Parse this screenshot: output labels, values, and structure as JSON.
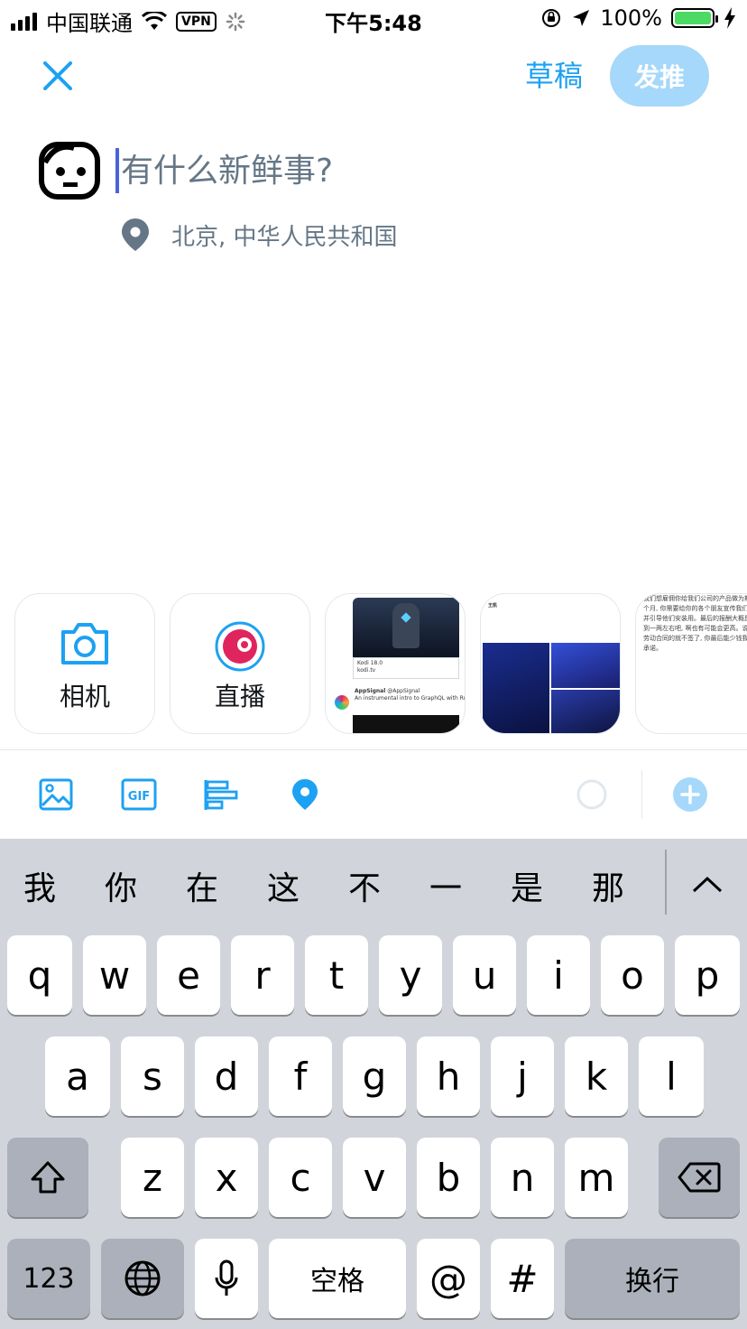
{
  "status_bar": {
    "carrier": "中国联通",
    "vpn": "VPN",
    "time": "下午5:48",
    "battery": "100%"
  },
  "header": {
    "drafts_label": "草稿",
    "tweet_label": "发推"
  },
  "compose": {
    "placeholder": "有什么新鲜事?",
    "value": "",
    "location": "北京, 中华人民共和国"
  },
  "media_tray": {
    "camera_label": "相机",
    "live_label": "直播",
    "thumbnails": [
      {
        "title": "Kodi 18.0",
        "site": "kodi.tv",
        "author": "AppSignal",
        "handle": "@AppSignal",
        "text": "An instrumental intro to GraphQL with Ruby"
      },
      {
        "author": "王凯"
      },
      {
        "text": "我们想雇佣你给我们公司的产品做为期大概一个月, 你需要给你的各个朋友宣传我们的产品并引导他们安装用。最后的报酬大概是两三毛到一两左右吧, 啊也有可能会更高。说不好然劳动合同的就不签了, 你最后能少钱我们也不承诺。"
      }
    ]
  },
  "toolbar": {
    "icons": [
      "image-icon",
      "gif-icon",
      "poll-icon",
      "location-pin-icon",
      "char-count-ring",
      "add-tweet-icon"
    ],
    "gif_text": "GIF"
  },
  "keyboard": {
    "candidates": [
      "我",
      "你",
      "在",
      "这",
      "不",
      "一",
      "是",
      "那"
    ],
    "row1": [
      "q",
      "w",
      "e",
      "r",
      "t",
      "y",
      "u",
      "i",
      "o",
      "p"
    ],
    "row2": [
      "a",
      "s",
      "d",
      "f",
      "g",
      "h",
      "j",
      "k",
      "l"
    ],
    "row3": [
      "z",
      "x",
      "c",
      "v",
      "b",
      "n",
      "m"
    ],
    "numbers_label": "123",
    "space_label": "空格",
    "at_label": "@",
    "hash_label": "#",
    "return_label": "换行"
  },
  "colors": {
    "accent": "#1da1f2",
    "tweet_button_disabled": "#a5d8fa",
    "keyboard_bg": "#d1d5db",
    "live_red": "#e0245e"
  }
}
